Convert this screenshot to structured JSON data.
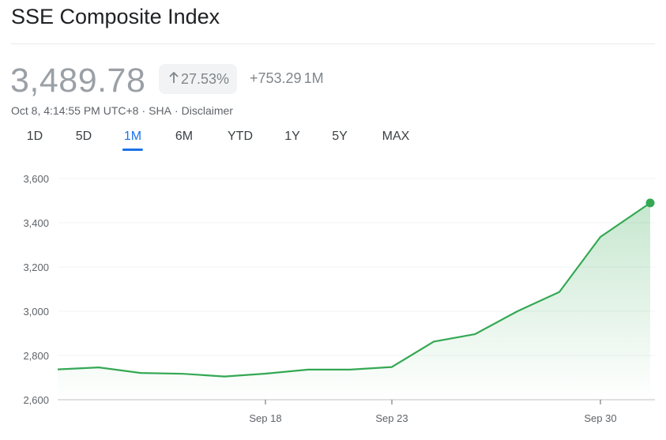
{
  "header": {
    "title": "SSE Composite Index"
  },
  "quote": {
    "price": "3,489.78",
    "change_percent": "27.53%",
    "change_arrow_icon": "arrow-up-icon",
    "change_absolute": "+753.29",
    "change_period": "1M",
    "timestamp": "Oct 8, 4:14:55 PM UTC+8",
    "exchange": "SHA",
    "disclaimer_label": "Disclaimer",
    "separator": "·"
  },
  "tabs": [
    {
      "label": "1D",
      "active": false
    },
    {
      "label": "5D",
      "active": false
    },
    {
      "label": "1M",
      "active": true
    },
    {
      "label": "6M",
      "active": false
    },
    {
      "label": "YTD",
      "active": false
    },
    {
      "label": "1Y",
      "active": false
    },
    {
      "label": "5Y",
      "active": false
    },
    {
      "label": "MAX",
      "active": false
    }
  ],
  "colors": {
    "line": "#34a853",
    "accent": "#1a73e8",
    "grid": "#f1f3f4"
  },
  "chart_data": {
    "type": "area",
    "title": "",
    "xlabel": "",
    "ylabel": "",
    "ylim": [
      2600,
      3600
    ],
    "yticks": [
      "3,600",
      "3,400",
      "3,200",
      "3,000",
      "2,800",
      "2,600"
    ],
    "ytick_values": [
      3600,
      3400,
      3200,
      3000,
      2800,
      2600
    ],
    "xticks": [
      {
        "label": "Sep 18",
        "index": 5
      },
      {
        "label": "Sep 23",
        "index": 8
      },
      {
        "label": "Sep 30",
        "index": 13
      }
    ],
    "grid": true,
    "series": [
      {
        "values": [
          2737,
          2746,
          2721,
          2717,
          2705,
          2718,
          2736,
          2736,
          2748,
          2863,
          2896,
          3000,
          3087,
          3336,
          3489.78
        ]
      }
    ]
  }
}
